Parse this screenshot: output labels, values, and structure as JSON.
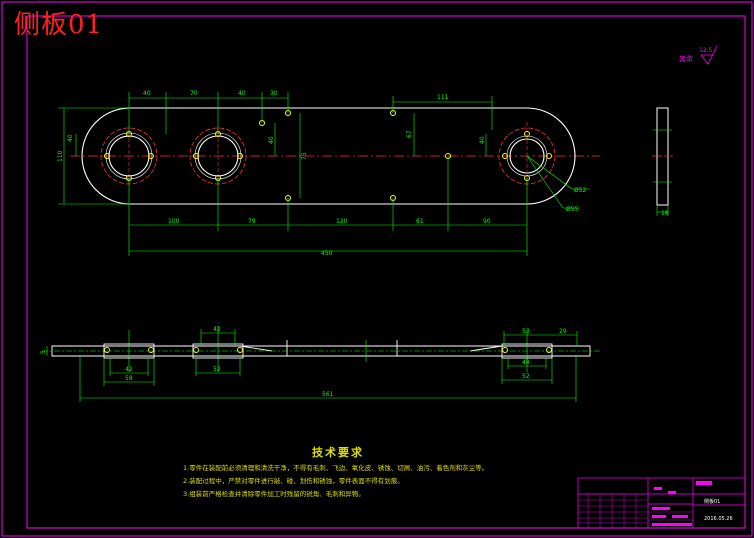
{
  "drawing": {
    "title": "侧板01",
    "roughness_label": "其余",
    "roughness_value": "12.5"
  },
  "dimensions": {
    "top_view": {
      "d40a": "40",
      "d70": "70",
      "d40b": "40",
      "d30": "30",
      "d111": "111",
      "d40_left": "40",
      "d110": "110",
      "d40_mid": "40",
      "d75": "75",
      "d67": "67",
      "d40_right": "40",
      "d100": "100",
      "d79": "79",
      "d120": "120",
      "d61": "61",
      "d90": "90",
      "d450": "450",
      "phi52": "Ø52",
      "phi55": "Ø55"
    },
    "side_view": {
      "d18": "18"
    },
    "section_view": {
      "d42_top": "42",
      "d42_left": "42",
      "d58": "58",
      "d52_mid": "52",
      "d53": "53",
      "d29": "29",
      "d48": "48",
      "d52_right": "52",
      "d561": "561",
      "d5": "5"
    }
  },
  "technical_requirements": {
    "title": "技术要求",
    "items": [
      "1.零件在装配前必须清理和清洗干净，不得有毛刺、飞边、氧化皮、锈蚀、切屑、油污、着色剂和灰尘等。",
      "2.装配过程中，严禁对零件进行敲、碰、划伤和锈蚀，零件表面不得有划痕。",
      "3.组装前严格检查并清除零件加工时残留的锐角、毛刺和异物。"
    ]
  },
  "title_block": {
    "part_name": "侧板01",
    "code": "2016.05.26"
  },
  "colors": {
    "border": "#ff00ff",
    "geometry": "#ffffff",
    "dimension": "#00ff00",
    "centerline": "#ff3030",
    "marker": "#ffff00",
    "text": "#dede00"
  }
}
